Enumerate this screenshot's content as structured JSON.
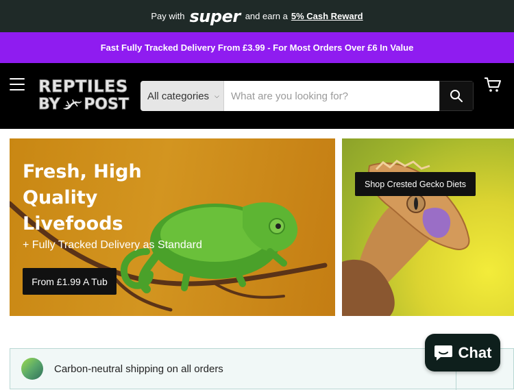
{
  "topbar": {
    "pay_with": "Pay with",
    "brand": "super",
    "earn": "and earn a",
    "reward": "5% Cash Reward"
  },
  "promo": {
    "text": "Fast Fully Tracked Delivery From £3.99 - For Most Orders Over £6 In Value"
  },
  "header": {
    "logo_line1": "REPTILES",
    "logo_by": "BY",
    "logo_post": "POST",
    "category": "All categories",
    "search_placeholder": "What are you looking for?"
  },
  "hero": {
    "title": "Fresh, High Quality Livefoods",
    "subtitle": "+ Fully Tracked Delivery as Standard",
    "cta": "From £1.99 A Tub"
  },
  "side_banner": {
    "cta": "Shop Crested Gecko Diets"
  },
  "carbon": {
    "text": "Carbon-neutral shipping on all orders"
  },
  "chat": {
    "label": "Chat"
  },
  "colors": {
    "topbar": "#1f2a28",
    "promo": "#8f1cf0",
    "header": "#000000",
    "hero": "#d39520"
  }
}
